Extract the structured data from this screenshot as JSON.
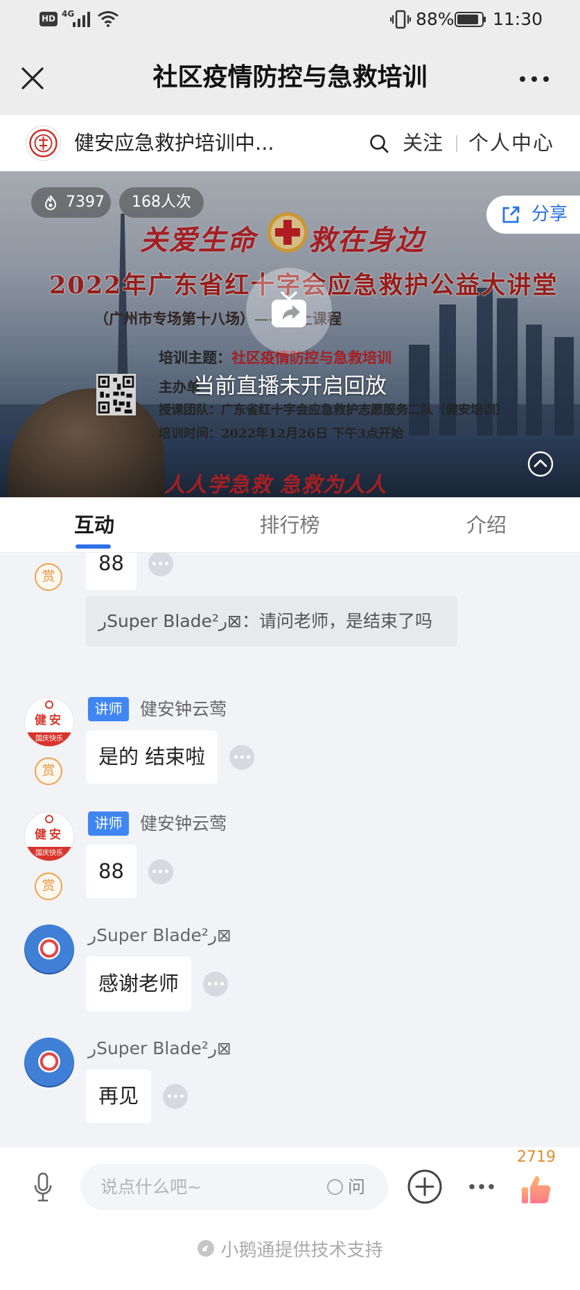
{
  "status_bar": {
    "hd_label": "HD",
    "network_type": "4G",
    "battery_percent": "88%",
    "battery_level": 0.88,
    "time": "11:30",
    "icons": [
      "signal-icon",
      "wifi-icon",
      "vibrate-icon",
      "battery-icon"
    ]
  },
  "title_bar": {
    "title": "社区疫情防控与急救培训",
    "close_icon": "close-icon",
    "more_icon": "more-icon"
  },
  "channel": {
    "logo_icon": "channel-logo",
    "name": "健安应急救护培训中...",
    "search_icon": "search-icon",
    "follow_label": "关注",
    "personal_center_label": "个人中心"
  },
  "video": {
    "heat_icon": "fire-icon",
    "heat_count": "7397",
    "view_count": "168人次",
    "share_icon": "share-icon",
    "share_label": "分享",
    "replay_icon": "tv-replay-icon",
    "status_text": "当前直播未开启回放",
    "collapse_icon": "chevron-up-icon",
    "poster": {
      "slogan_left": "关爱生命",
      "slogan_right": "救在身边",
      "headline": "2022年广东省红十字会应急救护公益大讲堂",
      "session": "（广州市专场第十八场）——线上课程",
      "topic_label": "培训主题：",
      "topic_value": "社区疫情防控与急救培训",
      "organizer_label": "主办单",
      "team": "授课团队：广东省红十字会应急救护志愿服务二队（健安培训）",
      "time": "培训时间：2022年12月26日  下午3点开始",
      "footer_slogan": "人人学急救  急救为人人"
    }
  },
  "tabs": [
    {
      "label": "互动",
      "active": true
    },
    {
      "label": "排行榜",
      "active": false
    },
    {
      "label": "介绍",
      "active": false
    }
  ],
  "chat": {
    "more_icon": "ellipsis-icon",
    "partial_message": {
      "text": "88",
      "reward_label": "赏"
    },
    "quoted_question": "رSuper Blade²ر⊠：请问老师，是结束了吗",
    "messages": [
      {
        "badge": "讲师",
        "name": "健安钟云莺",
        "text": "是的 结束啦",
        "reward_label": "赏",
        "avatar_text": "健安",
        "avatar_band": "国庆快乐"
      },
      {
        "badge": "讲师",
        "name": "健安钟云莺",
        "text": "88",
        "reward_label": "赏",
        "avatar_text": "健安",
        "avatar_band": "国庆快乐"
      },
      {
        "name": "رSuper Blade²ر⊠",
        "text": "感谢老师"
      },
      {
        "name": "رSuper Blade²ر⊠",
        "text": "再见"
      }
    ]
  },
  "composer": {
    "mic_icon": "microphone-icon",
    "placeholder": "说点什么吧~",
    "ask_label": "问",
    "plus_icon": "plus-icon",
    "more_icon": "more-icon",
    "like_icon": "thumbs-up-icon",
    "like_count": "2719"
  },
  "footer": {
    "icon": "xiaoe-logo-icon",
    "text": "小鹅通提供技术支持"
  },
  "colors": {
    "accent": "#2f6fe8",
    "teacher_badge": "#3f86f2",
    "reward": "#f0a04b",
    "like": "#e58a2d",
    "poster_red": "#c4262b",
    "chat_background": "#f2f3f7"
  }
}
